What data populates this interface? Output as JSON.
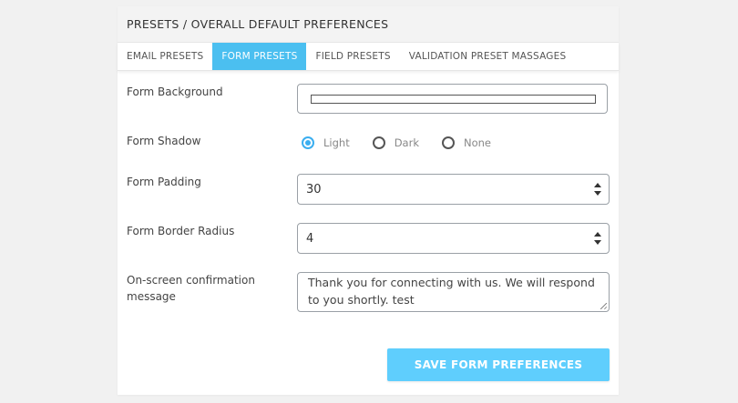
{
  "panel": {
    "title": "PRESETS / OVERALL DEFAULT PREFERENCES"
  },
  "tabs": [
    {
      "label": "EMAIL PRESETS",
      "active": false
    },
    {
      "label": "FORM PRESETS",
      "active": true
    },
    {
      "label": "FIELD PRESETS",
      "active": false
    },
    {
      "label": "VALIDATION PRESET MASSAGES",
      "active": false
    }
  ],
  "form": {
    "background": {
      "label": "Form Background",
      "value_color": "#ffffff"
    },
    "shadow": {
      "label": "Form Shadow",
      "options": [
        "Light",
        "Dark",
        "None"
      ],
      "selected": "Light"
    },
    "padding": {
      "label": "Form Padding",
      "value": "30"
    },
    "border_radius": {
      "label": "Form Border Radius",
      "value": "4"
    },
    "confirmation": {
      "label": "On-screen confirmation message",
      "value": "Thank you for connecting with us. We will respond to you shortly. test"
    }
  },
  "save_button": {
    "label": "SAVE FORM PREFERENCES"
  },
  "colors": {
    "accent": "#4bbff0",
    "button": "#5fcefd",
    "radio_checked": "#3aaef0"
  }
}
